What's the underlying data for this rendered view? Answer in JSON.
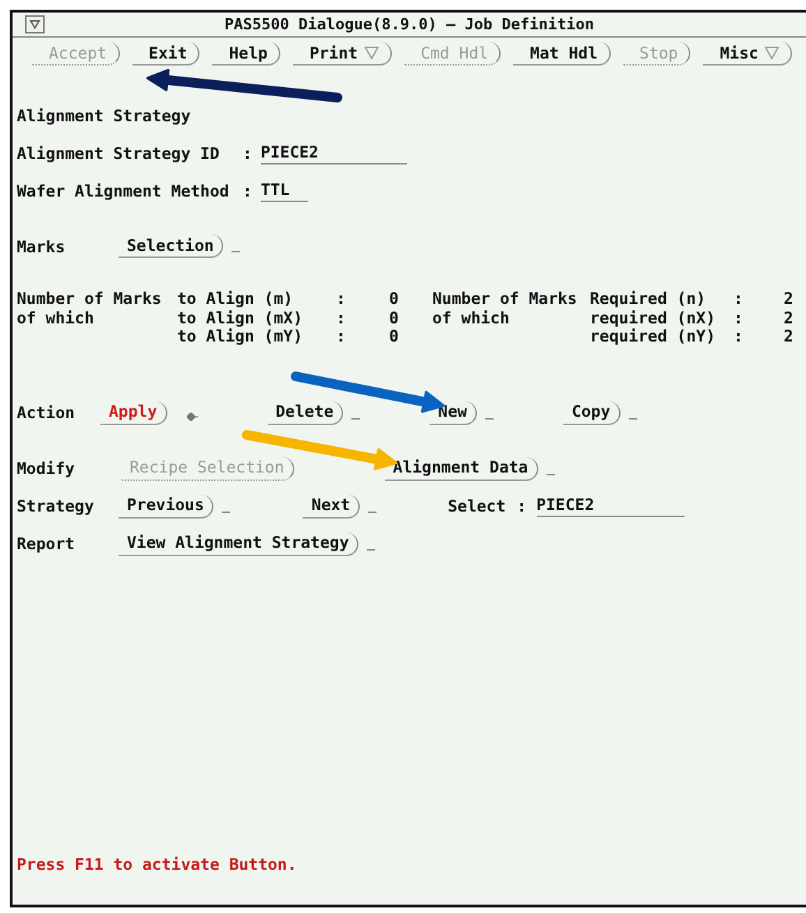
{
  "window": {
    "title": "PAS5500 Dialogue(8.9.0) – Job Definition"
  },
  "toolbar": [
    {
      "label": "Accept",
      "disabled": true,
      "dropdown": false
    },
    {
      "label": "Exit",
      "disabled": false,
      "dropdown": false
    },
    {
      "label": "Help",
      "disabled": false,
      "dropdown": false
    },
    {
      "label": "Print",
      "disabled": false,
      "dropdown": true
    },
    {
      "label": "Cmd Hdl",
      "disabled": true,
      "dropdown": false
    },
    {
      "label": "Mat Hdl",
      "disabled": false,
      "dropdown": false
    },
    {
      "label": "Stop",
      "disabled": true,
      "dropdown": false
    },
    {
      "label": "Misc",
      "disabled": false,
      "dropdown": true
    }
  ],
  "section_title": "Alignment Strategy",
  "fields": [
    {
      "label": "Alignment Strategy ID",
      "sep": ":",
      "value": "PIECE2"
    },
    {
      "label": "Wafer Alignment Method",
      "sep": ":",
      "value": "TTL"
    }
  ],
  "marks": {
    "label": "Marks",
    "button": {
      "label": "Selection",
      "disabled": false,
      "indicator": true
    }
  },
  "counts": [
    {
      "left_prefix": "Number of Marks",
      "left_label": "to Align (m)",
      "left_sep": ":",
      "left_value": "0",
      "right_prefix": "Number of Marks",
      "right_label": "Required (n)",
      "right_sep": ":",
      "right_value": "2"
    },
    {
      "left_prefix": "of which",
      "left_label": "to Align (mX)",
      "left_sep": ":",
      "left_value": "0",
      "right_prefix": "of which",
      "right_label": "required (nX)",
      "right_sep": ":",
      "right_value": "2"
    },
    {
      "left_label": "to Align (mY)",
      "left_sep": ":",
      "left_value": "0",
      "right_label": "required (nY)",
      "right_sep": ":",
      "right_value": "2"
    }
  ],
  "action": {
    "label": "Action",
    "buttons": [
      {
        "label": "Apply",
        "disabled": false,
        "highlighted": true,
        "indicator": false,
        "pointer": true
      },
      {
        "label": "Delete",
        "disabled": false,
        "highlighted": false,
        "indicator": true,
        "pointer": false
      },
      {
        "label": "New",
        "disabled": false,
        "highlighted": false,
        "indicator": true,
        "pointer": false
      },
      {
        "label": "Copy",
        "disabled": false,
        "highlighted": false,
        "indicator": true,
        "pointer": false
      }
    ]
  },
  "modify": {
    "label": "Modify",
    "buttons": [
      {
        "label": "Recipe Selection",
        "disabled": true,
        "indicator": false
      },
      {
        "label": "Alignment Data",
        "disabled": false,
        "indicator": true
      }
    ]
  },
  "strategy": {
    "label": "Strategy",
    "buttons": [
      {
        "label": "Previous",
        "disabled": false,
        "indicator": true
      },
      {
        "label": "Next",
        "disabled": false,
        "indicator": true
      }
    ],
    "select_label": "Select",
    "select_sep": ":",
    "select_value": "PIECE2"
  },
  "report": {
    "label": "Report",
    "button": {
      "label": "View Alignment Strategy",
      "disabled": false,
      "indicator": true
    }
  },
  "status": "Press F11 to activate Button.",
  "annotations": [
    {
      "color": "#0a1f5c"
    },
    {
      "color": "#0a63c0"
    },
    {
      "color": "#f7b500"
    }
  ]
}
